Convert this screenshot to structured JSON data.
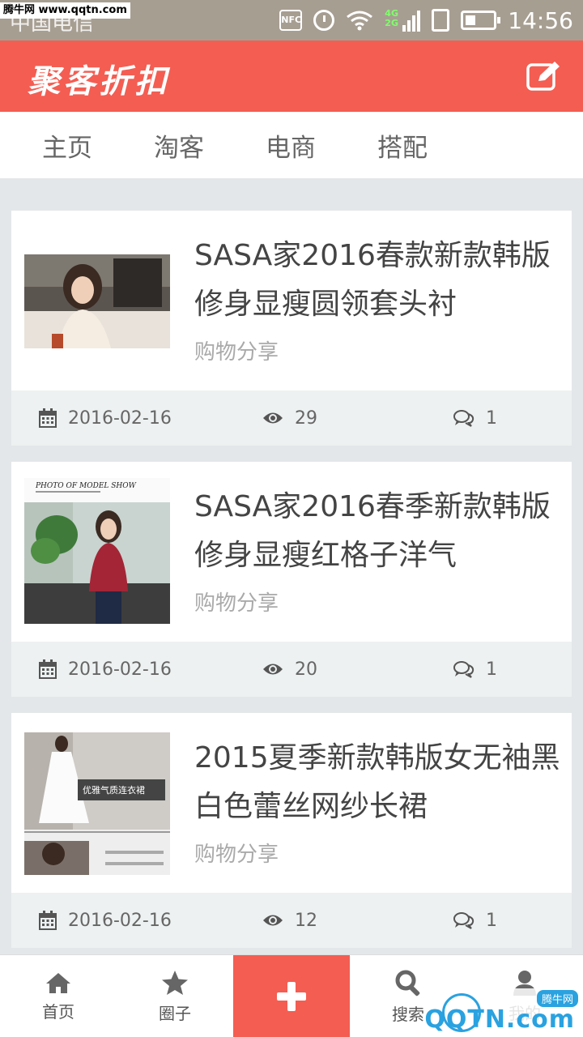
{
  "status_bar": {
    "watermark": "腾牛网 www.qqtn.com",
    "carrier": "中国电信",
    "nfc": "NFC",
    "network_top": "4G",
    "network_bottom": "2G",
    "time": "14:56"
  },
  "header": {
    "title": "聚客折扣",
    "edit_icon": "edit-icon"
  },
  "nav": {
    "tabs": [
      "主页",
      "淘客",
      "电商",
      "搭配"
    ]
  },
  "posts": [
    {
      "title": "SASA家2016春款新款韩版修身显瘦圆领套头衬",
      "category": "购物分享",
      "date": "2016-02-16",
      "views": "29",
      "comments": "1"
    },
    {
      "title": "SASA家2016春季新款韩版修身显瘦红格子洋气",
      "category": "购物分享",
      "date": "2016-02-16",
      "views": "20",
      "comments": "1",
      "thumb_caption": "PHOTO OF MODEL SHOW"
    },
    {
      "title": "2015夏季新款韩版女无袖黑白色蕾丝网纱长裙",
      "category": "购物分享",
      "date": "2016-02-16",
      "views": "12",
      "comments": "1",
      "thumb_caption": "优雅气质连衣裙"
    }
  ],
  "bottom_nav": {
    "home": "首页",
    "circle": "圈子",
    "search": "搜索",
    "mine": "我的"
  },
  "watermark_bottom": {
    "text": "QQTN.com",
    "badge": "腾牛网"
  },
  "colors": {
    "accent": "#f45d52",
    "status_bar": "#a79e92",
    "meta_bg": "#edf1f1"
  }
}
